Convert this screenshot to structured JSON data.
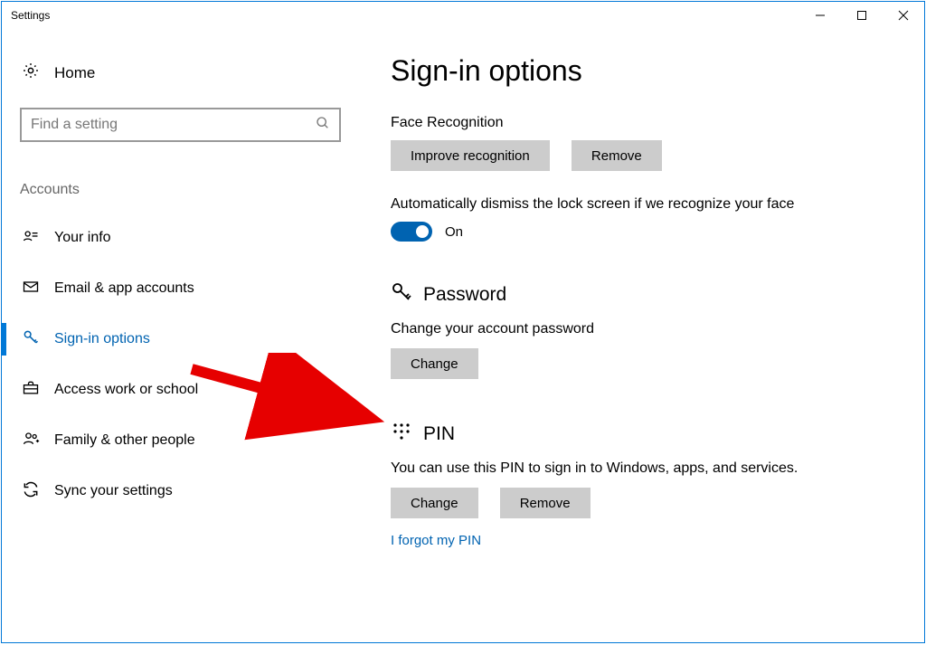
{
  "window": {
    "title": "Settings"
  },
  "sidebar": {
    "home": "Home",
    "search_placeholder": "Find a setting",
    "section": "Accounts",
    "items": [
      {
        "label": "Your info"
      },
      {
        "label": "Email & app accounts"
      },
      {
        "label": "Sign-in options"
      },
      {
        "label": "Access work or school"
      },
      {
        "label": "Family & other people"
      },
      {
        "label": "Sync your settings"
      }
    ]
  },
  "main": {
    "title": "Sign-in options",
    "face": {
      "heading": "Face Recognition",
      "improve": "Improve recognition",
      "remove": "Remove",
      "auto_desc": "Automatically dismiss the lock screen if we recognize your face",
      "toggle_label": "On"
    },
    "password": {
      "heading": "Password",
      "desc": "Change your account password",
      "change": "Change"
    },
    "pin": {
      "heading": "PIN",
      "desc": "You can use this PIN to sign in to Windows, apps, and services.",
      "change": "Change",
      "remove": "Remove",
      "forgot": "I forgot my PIN"
    }
  }
}
